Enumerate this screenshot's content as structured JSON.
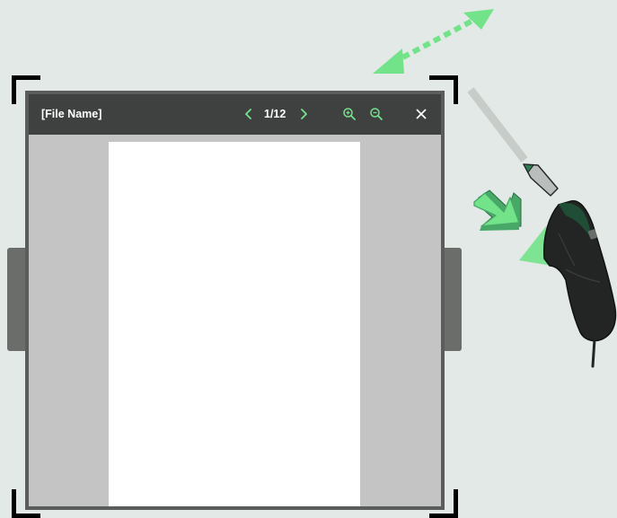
{
  "viewer": {
    "file_name": "[File Name]",
    "page_indicator": "1/12"
  },
  "icons": {
    "prev_page": "chevron-left-icon",
    "next_page": "chevron-right-icon",
    "zoom_in": "zoom-in-icon",
    "zoom_out": "zoom-out-icon",
    "close": "close-icon",
    "resize_arrow": "diagonal-double-arrow-icon",
    "press_arrow": "press-arrow-icon",
    "pointer_ray": "pointer-ray-icon",
    "controller": "vr-controller-icon"
  },
  "colors": {
    "background": "#e2e9e6",
    "toolbar": "#3f4140",
    "accent": "#73e38a",
    "accent_dark": "#48a868",
    "frame": "#5b5d5c",
    "bracket_gray": "#8e918f",
    "page": "#ffffff",
    "document_bg": "#c4c4c4",
    "controller": "#222523"
  }
}
